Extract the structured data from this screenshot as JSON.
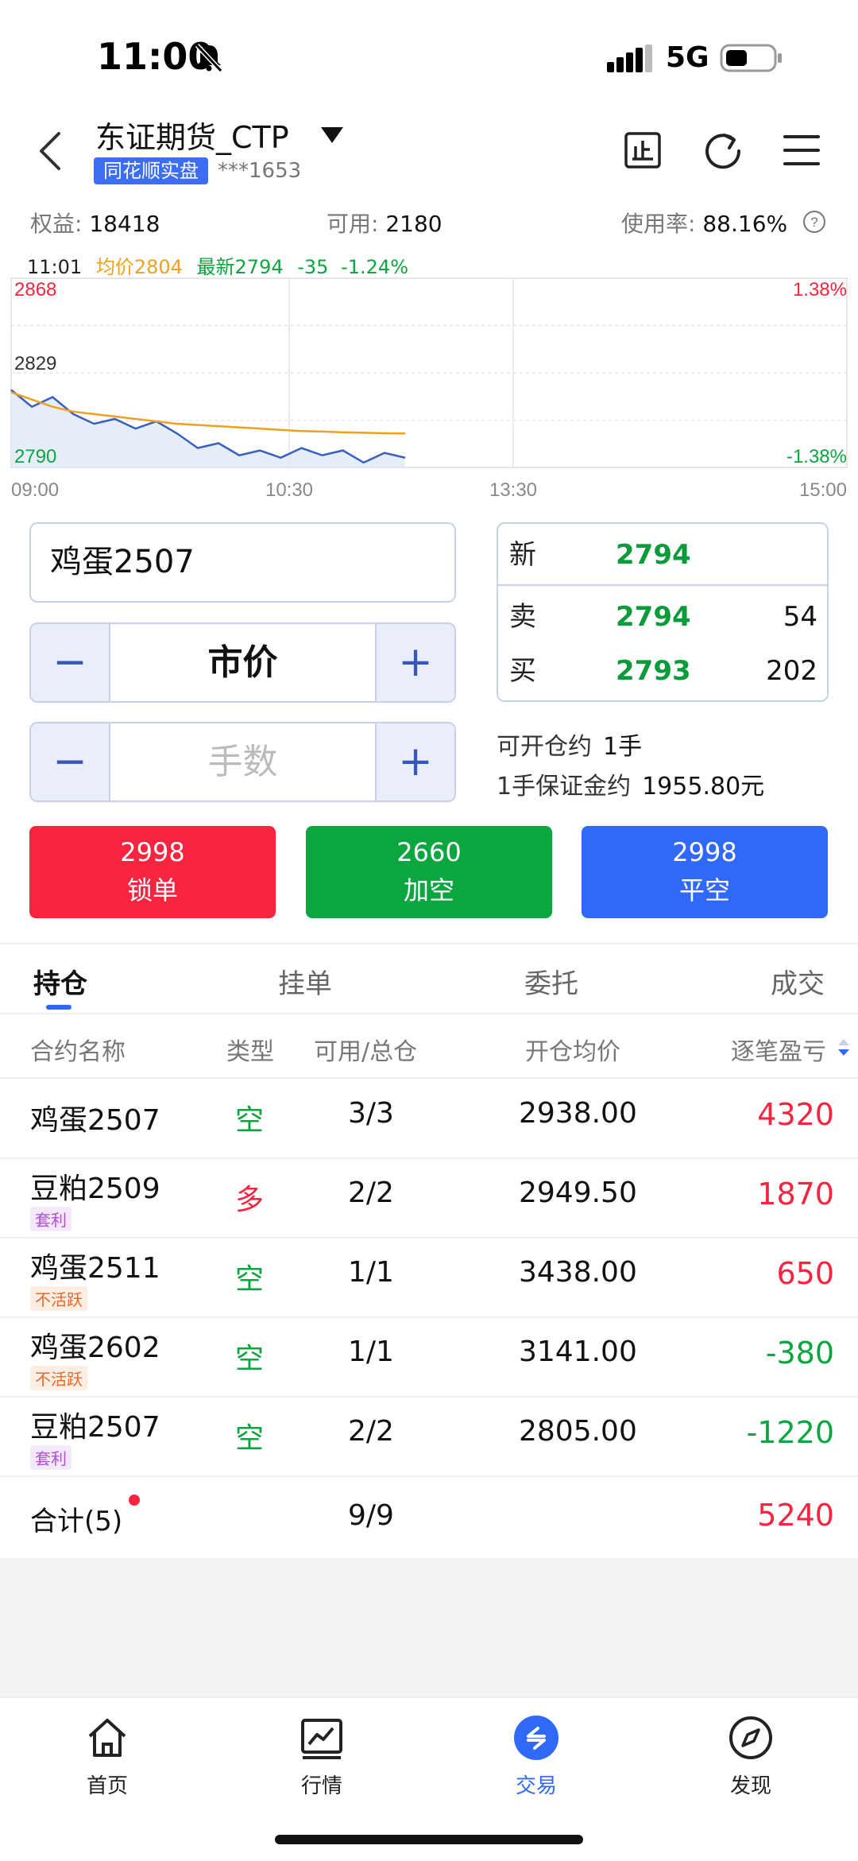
{
  "status_bar": {
    "time": "11:00",
    "network": "5G"
  },
  "header": {
    "title": "东证期货_CTP",
    "badge": "同花顺实盘",
    "account_masked": "***1653"
  },
  "summary": {
    "equity_label": "权益:",
    "equity_value": "18418",
    "available_label": "可用:",
    "available_value": "2180",
    "usage_label": "使用率:",
    "usage_value": "88.16%"
  },
  "chart_info": {
    "time": "11:01",
    "avg_label": "均价",
    "avg_value": "2804",
    "latest_label": "最新",
    "latest_value": "2794",
    "change": "-35",
    "change_pct": "-1.24%"
  },
  "chart_data": {
    "type": "line",
    "x_ticks": [
      "09:00",
      "10:30",
      "13:30",
      "15:00"
    ],
    "y_labels_left": [
      "2868",
      "2829",
      "2790"
    ],
    "y_labels_right": [
      "1.38%",
      "-1.38%"
    ],
    "ylim": [
      2790,
      2868
    ],
    "series": [
      {
        "name": "均价",
        "color": "#f0a020",
        "values": [
          2821,
          2818,
          2815,
          2813,
          2812,
          2811,
          2810,
          2809,
          2808,
          2807.5,
          2807,
          2806.5,
          2806,
          2805.5,
          2805,
          2804.8,
          2804.5,
          2804.3,
          2804.1,
          2804
        ]
      },
      {
        "name": "最新",
        "color": "#3a5fc0",
        "values": [
          2822,
          2815,
          2819,
          2812,
          2808,
          2810,
          2806,
          2809,
          2804,
          2798,
          2800,
          2795,
          2797,
          2794,
          2798,
          2795,
          2797,
          2792,
          2796,
          2794
        ]
      }
    ]
  },
  "order": {
    "contract": "鸡蛋2507",
    "price_mode": "市价",
    "qty_placeholder": "手数",
    "minus": "−",
    "plus": "+"
  },
  "quote": {
    "new_label": "新",
    "new_price": "2794",
    "ask_label": "卖",
    "ask_price": "2794",
    "ask_vol": "54",
    "bid_label": "买",
    "bid_price": "2793",
    "bid_vol": "202"
  },
  "open_info": {
    "can_open_label": "可开仓约",
    "can_open_value": "1手",
    "margin_label": "1手保证金约",
    "margin_value": "1955.80元"
  },
  "buttons": {
    "lock": {
      "price": "2998",
      "label": "锁单"
    },
    "short": {
      "price": "2660",
      "label": "加空"
    },
    "close": {
      "price": "2998",
      "label": "平空"
    }
  },
  "tabs": [
    "持仓",
    "挂单",
    "委托",
    "成交"
  ],
  "table": {
    "headers": [
      "合约名称",
      "类型",
      "可用/总仓",
      "开仓均价",
      "逐笔盈亏"
    ],
    "rows": [
      {
        "name": "鸡蛋2507",
        "tag": "",
        "type": "空",
        "pos": "3/3",
        "avg": "2938.00",
        "pnl": "4320"
      },
      {
        "name": "豆粕2509",
        "tag": "套利",
        "type": "多",
        "pos": "2/2",
        "avg": "2949.50",
        "pnl": "1870"
      },
      {
        "name": "鸡蛋2511",
        "tag": "不活跃",
        "type": "空",
        "pos": "1/1",
        "avg": "3438.00",
        "pnl": "650"
      },
      {
        "name": "鸡蛋2602",
        "tag": "不活跃",
        "type": "空",
        "pos": "1/1",
        "avg": "3141.00",
        "pnl": "-380"
      },
      {
        "name": "豆粕2507",
        "tag": "套利",
        "type": "空",
        "pos": "2/2",
        "avg": "2805.00",
        "pnl": "-1220"
      }
    ],
    "total_label": "合计(5)",
    "total_pos": "9/9",
    "total_pnl": "5240"
  },
  "nav": [
    {
      "label": "首页",
      "icon": "home-icon"
    },
    {
      "label": "行情",
      "icon": "chart-icon"
    },
    {
      "label": "交易",
      "icon": "trade-icon"
    },
    {
      "label": "发现",
      "icon": "compass-icon"
    }
  ],
  "colors": {
    "accent": "#3068f8",
    "up": "#f7243f",
    "down": "#0ba63f"
  }
}
